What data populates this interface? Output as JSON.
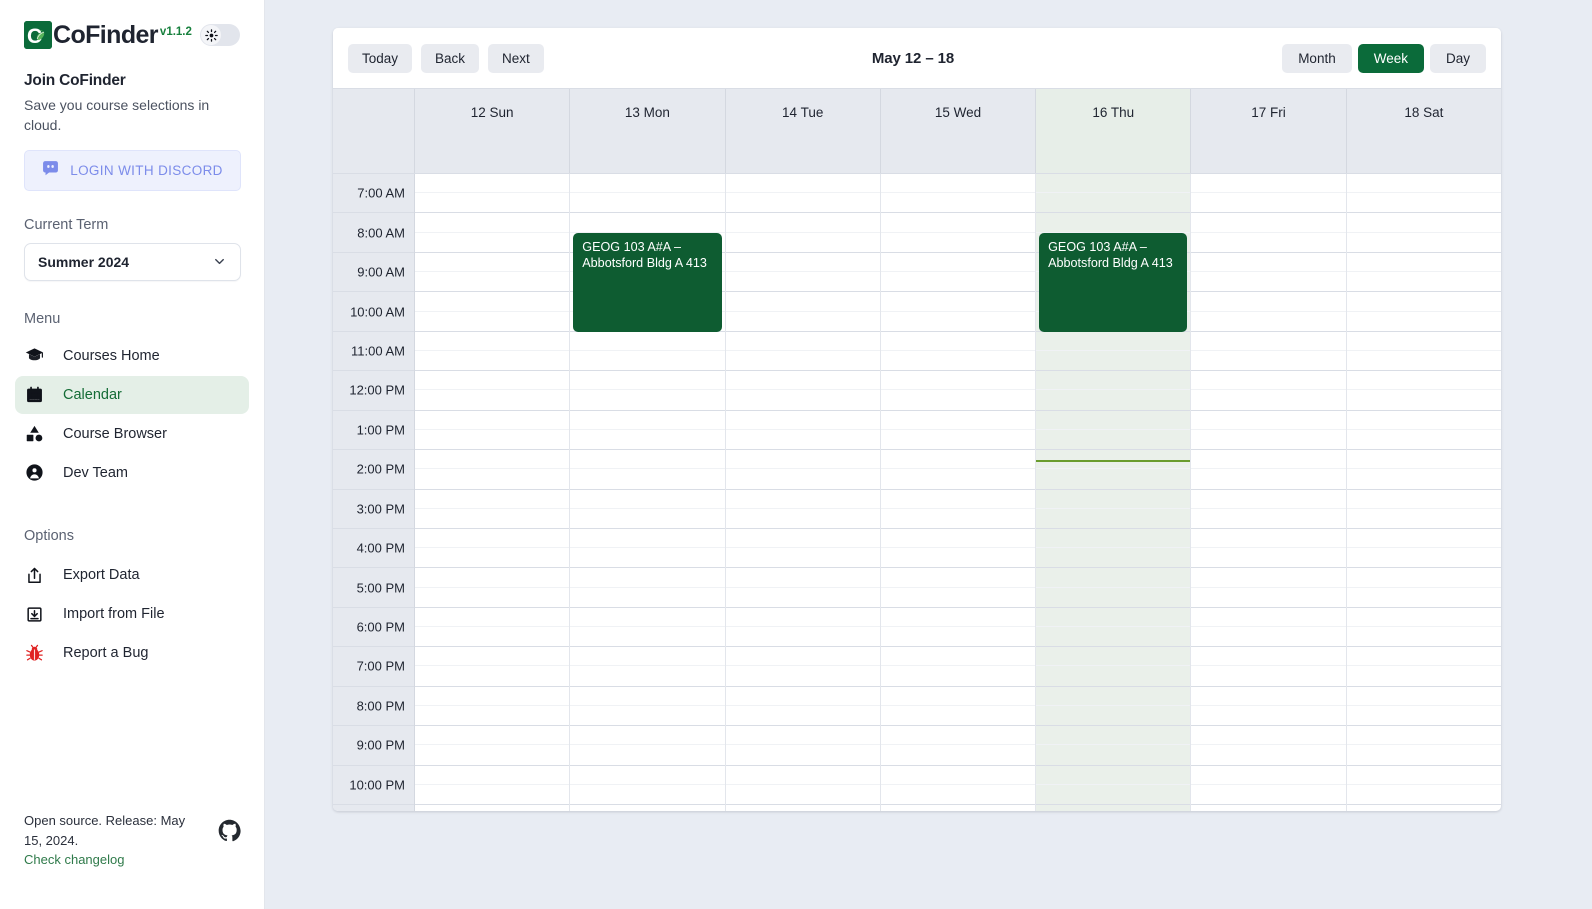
{
  "app": {
    "brand_name": "CoFinder",
    "brand_version": "v1.1.2",
    "theme_toggle_icon": "sun-icon",
    "accent_green": "#0b6b3a",
    "event_green": "#0e5c31",
    "now_line_color": "#6a9c2e"
  },
  "sidebar": {
    "join": {
      "title": "Join CoFinder",
      "subtitle": "Save you course selections in cloud.",
      "discord_button_label": "LOGIN WITH DISCORD",
      "discord_button_icon": "discord-icon"
    },
    "term": {
      "label": "Current Term",
      "value": "Summer 2024",
      "chevron_icon": "chevron-down-icon"
    },
    "menu": {
      "label": "Menu",
      "items": [
        {
          "label": "Courses Home",
          "icon": "graduation-cap-icon",
          "active": false
        },
        {
          "label": "Calendar",
          "icon": "calendar-icon",
          "active": true
        },
        {
          "label": "Course Browser",
          "icon": "shapes-icon",
          "active": false
        },
        {
          "label": "Dev Team",
          "icon": "user-circle-icon",
          "active": false
        }
      ]
    },
    "options": {
      "label": "Options",
      "items": [
        {
          "label": "Export Data",
          "icon": "share-export-icon"
        },
        {
          "label": "Import from File",
          "icon": "import-download-icon"
        },
        {
          "label": "Report a Bug",
          "icon": "bug-icon"
        }
      ]
    },
    "footer": {
      "text": "Open source. Release: May 15, 2024.",
      "link": "Check changelog",
      "github_icon": "github-icon"
    }
  },
  "calendar": {
    "toolbar": {
      "today_label": "Today",
      "back_label": "Back",
      "next_label": "Next",
      "title": "May 12 – 18",
      "views": [
        {
          "label": "Month",
          "active": false
        },
        {
          "label": "Week",
          "active": true
        },
        {
          "label": "Day",
          "active": false
        }
      ]
    },
    "days": [
      {
        "label": "12 Sun",
        "today": false
      },
      {
        "label": "13 Mon",
        "today": false
      },
      {
        "label": "14 Tue",
        "today": false
      },
      {
        "label": "15 Wed",
        "today": false
      },
      {
        "label": "16 Thu",
        "today": true
      },
      {
        "label": "17 Fri",
        "today": false
      },
      {
        "label": "18 Sat",
        "today": false
      }
    ],
    "time_slots": [
      "7:00 AM",
      "8:00 AM",
      "9:00 AM",
      "10:00 AM",
      "11:00 AM",
      "12:00 PM",
      "1:00 PM",
      "2:00 PM",
      "3:00 PM",
      "4:00 PM",
      "5:00 PM",
      "6:00 PM",
      "7:00 PM",
      "8:00 PM",
      "9:00 PM",
      "10:00 PM"
    ],
    "events": [
      {
        "title": "GEOG 103 A#A – Abbotsford Bldg A 413",
        "day_index": 1,
        "start": "8:30 AM",
        "end": "11:00 AM"
      },
      {
        "title": "GEOG 103 A#A – Abbotsford Bldg A 413",
        "day_index": 4,
        "start": "8:30 AM",
        "end": "11:00 AM"
      }
    ],
    "current_time_day_index": 4,
    "current_time": "2:15 PM"
  }
}
